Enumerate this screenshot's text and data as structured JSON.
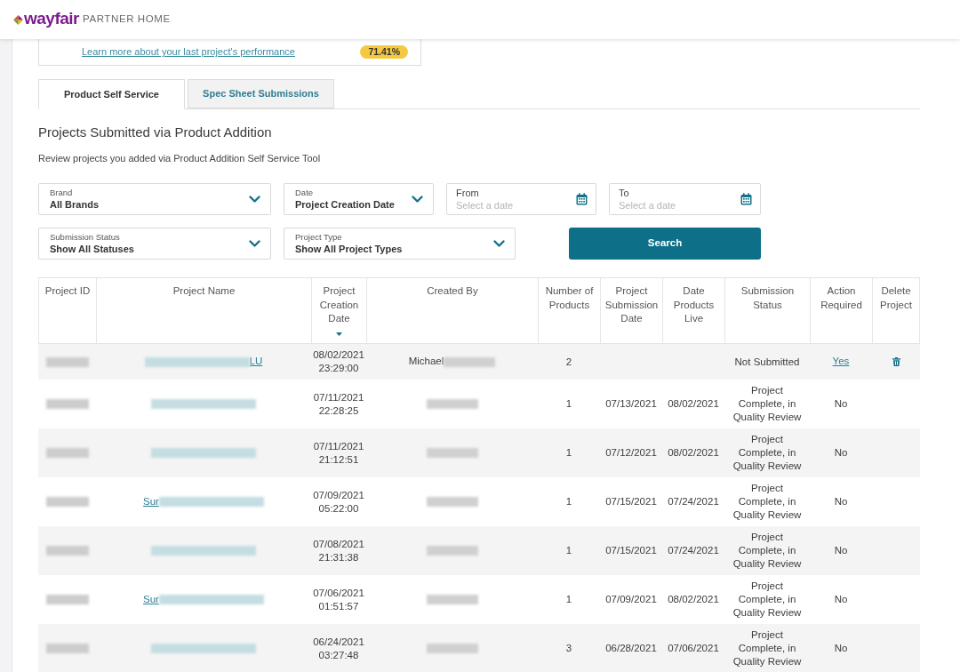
{
  "header": {
    "logo_text": "wayfair",
    "subtitle": "PARTNER HOME"
  },
  "performance_card": {
    "link": "Learn more about your last project's performance",
    "score": "71.41%"
  },
  "tabs": [
    {
      "label": "Product Self Service",
      "selected": true
    },
    {
      "label": "Spec Sheet Submissions",
      "selected": false
    }
  ],
  "section": {
    "title": "Projects Submitted via Product Addition",
    "description": "Review projects you added via Product Addition Self Service Tool"
  },
  "filter_rows": [
    {
      "items": [
        {
          "kind": "select",
          "label": "Brand",
          "value": "All Brands"
        },
        {
          "kind": "select",
          "label": "Date",
          "value": "Project Creation Date"
        },
        {
          "kind": "date",
          "label": "From",
          "placeholder": "Select a date"
        },
        {
          "kind": "date",
          "label": "To",
          "placeholder": "Select a date"
        }
      ]
    },
    {
      "items": [
        {
          "kind": "select",
          "label": "Submission Status",
          "value": "Show All Statuses"
        },
        {
          "kind": "select",
          "label": "Project Type",
          "value": "Show All Project Types"
        },
        {
          "kind": "button",
          "label": "Search"
        }
      ]
    }
  ],
  "table": {
    "columns": [
      {
        "label": "Project ID",
        "sorted": false
      },
      {
        "label": "Project Name",
        "sorted": false
      },
      {
        "label": "Project Creation Date",
        "sorted": true
      },
      {
        "label": "Created By",
        "sorted": false
      },
      {
        "label": "Number of Products",
        "sorted": false
      },
      {
        "label": "Project Submission Date",
        "sorted": false
      },
      {
        "label": "Date Products Live",
        "sorted": false
      },
      {
        "label": "Submission Status",
        "sorted": false
      },
      {
        "label": "Action Required",
        "sorted": false
      },
      {
        "label": "Delete Project",
        "sorted": false
      }
    ],
    "rows": [
      {
        "project_id": [
          {
            "kind": "redacted"
          }
        ],
        "project_name": [
          {
            "kind": "redacted"
          },
          {
            "kind": "link",
            "text": "LU"
          }
        ],
        "creation_date": "08/02/2021",
        "creation_time": "23:29:00",
        "created_by": [
          {
            "kind": "text",
            "text": "Michael"
          },
          {
            "kind": "redacted"
          }
        ],
        "number_of_products": "2",
        "submission_status": "Not Submitted",
        "action_required": {
          "kind": "link",
          "text": "Yes"
        },
        "deletable": true
      },
      {
        "project_id": [
          {
            "kind": "redacted"
          }
        ],
        "project_name": [
          {
            "kind": "redacted"
          }
        ],
        "creation_date": "07/11/2021",
        "creation_time": "22:28:25",
        "created_by": [
          {
            "kind": "redacted"
          }
        ],
        "number_of_products": "1",
        "submission_date": "07/13/2021",
        "date_products_live": "08/02/2021",
        "submission_status": "Project Complete, in Quality Review",
        "action_required": {
          "kind": "text",
          "text": "No"
        },
        "deletable": false
      },
      {
        "project_id": [
          {
            "kind": "redacted"
          }
        ],
        "project_name": [
          {
            "kind": "redacted"
          }
        ],
        "creation_date": "07/11/2021",
        "creation_time": "21:12:51",
        "created_by": [
          {
            "kind": "redacted"
          }
        ],
        "number_of_products": "1",
        "submission_date": "07/12/2021",
        "date_products_live": "08/02/2021",
        "submission_status": "Project Complete, in Quality Review",
        "action_required": {
          "kind": "text",
          "text": "No"
        },
        "deletable": false
      },
      {
        "project_id": [
          {
            "kind": "redacted"
          }
        ],
        "project_name": [
          {
            "kind": "link",
            "text": "Sur"
          },
          {
            "kind": "redacted"
          }
        ],
        "creation_date": "07/09/2021",
        "creation_time": "05:22:00",
        "created_by": [
          {
            "kind": "redacted"
          }
        ],
        "number_of_products": "1",
        "submission_date": "07/15/2021",
        "date_products_live": "07/24/2021",
        "submission_status": "Project Complete, in Quality Review",
        "action_required": {
          "kind": "text",
          "text": "No"
        },
        "deletable": false
      },
      {
        "project_id": [
          {
            "kind": "redacted"
          }
        ],
        "project_name": [
          {
            "kind": "redacted"
          }
        ],
        "creation_date": "07/08/2021",
        "creation_time": "21:31:38",
        "created_by": [
          {
            "kind": "redacted"
          }
        ],
        "number_of_products": "1",
        "submission_date": "07/15/2021",
        "date_products_live": "07/24/2021",
        "submission_status": "Project Complete, in Quality Review",
        "action_required": {
          "kind": "text",
          "text": "No"
        },
        "deletable": false
      },
      {
        "project_id": [
          {
            "kind": "redacted"
          }
        ],
        "project_name": [
          {
            "kind": "link",
            "text": "Sur"
          },
          {
            "kind": "redacted"
          }
        ],
        "creation_date": "07/06/2021",
        "creation_time": "01:51:57",
        "created_by": [
          {
            "kind": "redacted"
          }
        ],
        "number_of_products": "1",
        "submission_date": "07/09/2021",
        "date_products_live": "08/02/2021",
        "submission_status": "Project Complete, in Quality Review",
        "action_required": {
          "kind": "text",
          "text": "No"
        },
        "deletable": false
      },
      {
        "project_id": [
          {
            "kind": "redacted"
          }
        ],
        "project_name": [
          {
            "kind": "redacted"
          }
        ],
        "creation_date": "06/24/2021",
        "creation_time": "03:27:48",
        "created_by": [
          {
            "kind": "redacted"
          }
        ],
        "number_of_products": "3",
        "submission_date": "06/28/2021",
        "date_products_live": "07/06/2021",
        "submission_status": "Project Complete, in Quality Review",
        "action_required": {
          "kind": "text",
          "text": "No"
        },
        "deletable": false
      }
    ]
  }
}
